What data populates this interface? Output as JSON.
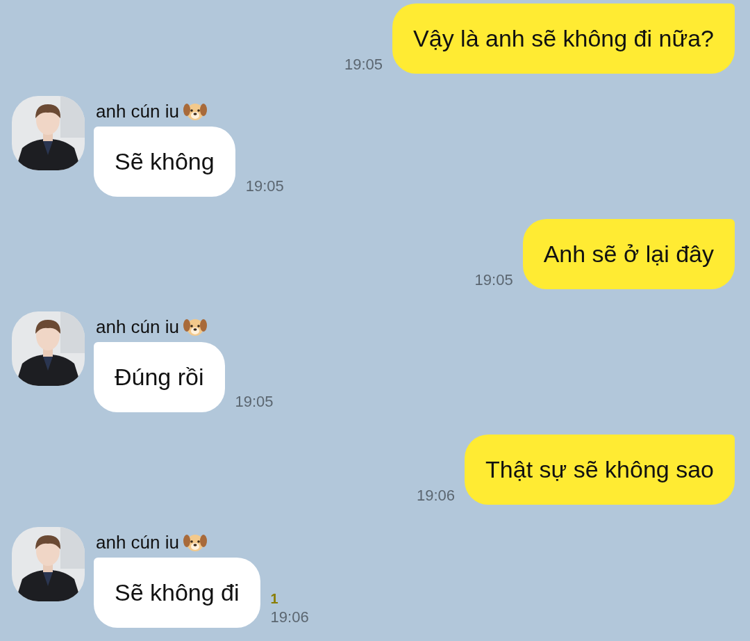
{
  "messages": [
    {
      "kind": "sent",
      "text": "Vậy là anh sẽ không đi nữa?",
      "time": "19:05"
    },
    {
      "kind": "received",
      "sender": "anh cún iu",
      "text": "Sẽ không",
      "time": "19:05"
    },
    {
      "kind": "sent",
      "text": "Anh sẽ ở lại đây",
      "time": "19:05"
    },
    {
      "kind": "received",
      "sender": "anh cún iu",
      "text": "Đúng rồi",
      "time": "19:05"
    },
    {
      "kind": "sent",
      "text": "Thật sự sẽ không sao",
      "time": "19:06"
    },
    {
      "kind": "received",
      "sender": "anh cún iu",
      "text": "Sẽ không đi",
      "time": "19:06",
      "unread": "1"
    }
  ]
}
